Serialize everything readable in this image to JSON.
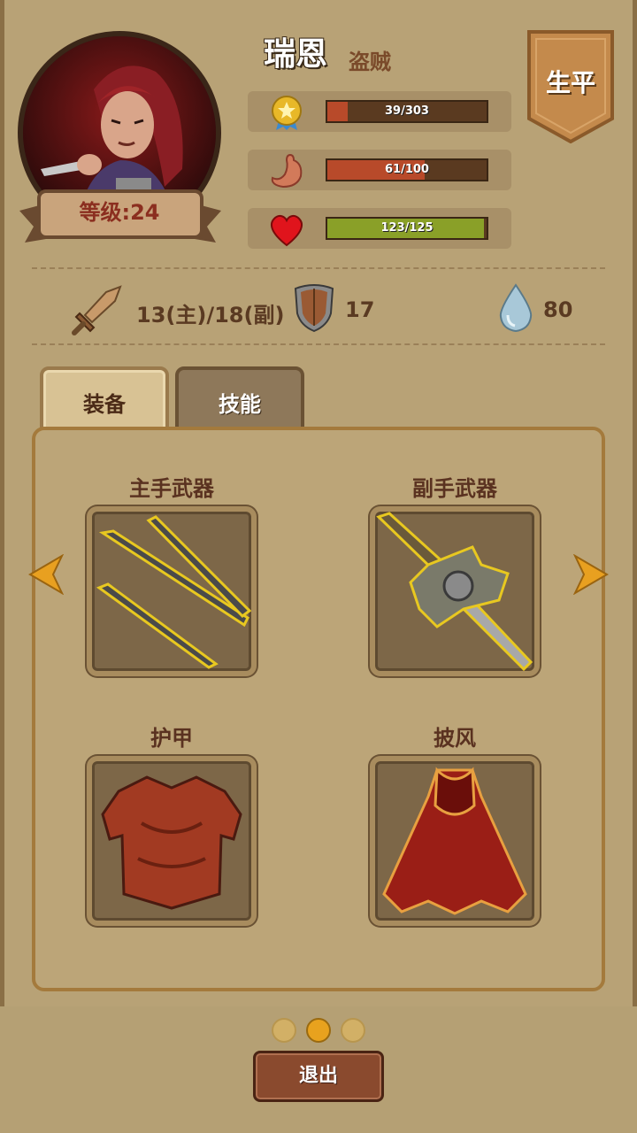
{
  "character": {
    "name": "瑞恩",
    "class": "盗贼",
    "level_label": "等级:24"
  },
  "banner": {
    "label": "生平"
  },
  "stats": {
    "xp": {
      "icon": "medal-icon",
      "text": "39/303",
      "current": 39,
      "max": 303,
      "color": "#b84a2a"
    },
    "hunger": {
      "icon": "stomach-icon",
      "text": "61/100",
      "current": 61,
      "max": 100,
      "color": "#b84a2a"
    },
    "health": {
      "icon": "heart-icon",
      "text": "123/125",
      "current": 123,
      "max": 125,
      "color": "#8aa028"
    }
  },
  "attributes": {
    "attack": {
      "icon": "sword-icon",
      "value": "13(主)/18(副)"
    },
    "defense": {
      "icon": "shield-icon",
      "value": "17"
    },
    "water": {
      "icon": "water-drop-icon",
      "value": "80"
    }
  },
  "tabs": [
    {
      "label": "装备",
      "active": true
    },
    {
      "label": "技能",
      "active": false
    }
  ],
  "equipment": {
    "main_weapon": {
      "label": "主手武器",
      "icon": "claw-blades-icon"
    },
    "off_weapon": {
      "label": "副手武器",
      "icon": "short-sword-icon"
    },
    "armor": {
      "label": "护甲",
      "icon": "leather-armor-icon"
    },
    "cloak": {
      "label": "披风",
      "icon": "red-cloak-icon"
    }
  },
  "pagination": {
    "total": 3,
    "current": 2
  },
  "exit_label": "退出"
}
